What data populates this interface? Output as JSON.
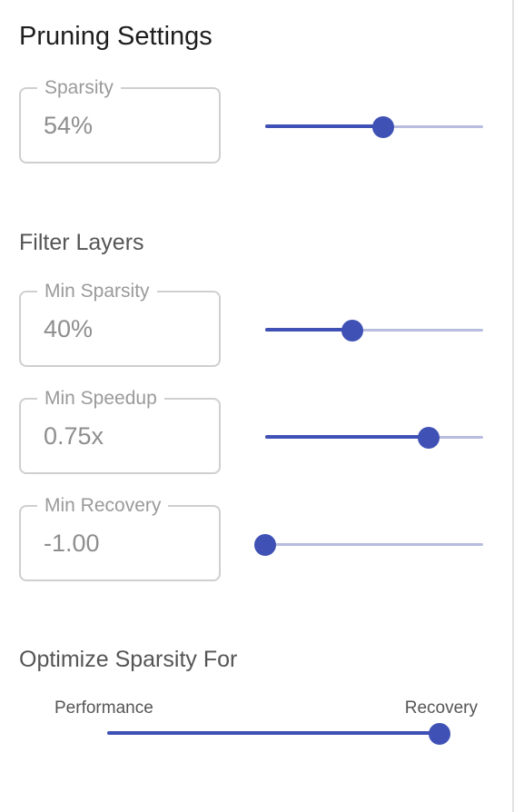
{
  "panel": {
    "title": "Pruning Settings"
  },
  "sparsity": {
    "label": "Sparsity",
    "value": "54%",
    "slider_fraction": 0.54
  },
  "filter_layers": {
    "title": "Filter Layers",
    "min_sparsity": {
      "label": "Min Sparsity",
      "value": "40%",
      "slider_fraction": 0.4
    },
    "min_speedup": {
      "label": "Min Speedup",
      "value": "0.75x",
      "slider_fraction": 0.75
    },
    "min_recovery": {
      "label": "Min Recovery",
      "value": "-1.00",
      "slider_fraction": 0.0
    }
  },
  "optimize": {
    "title": "Optimize Sparsity For",
    "left_label": "Performance",
    "right_label": "Recovery",
    "slider_fraction": 1.0
  },
  "colors": {
    "accent": "#3f51b5",
    "rail": "#b8bcde"
  }
}
